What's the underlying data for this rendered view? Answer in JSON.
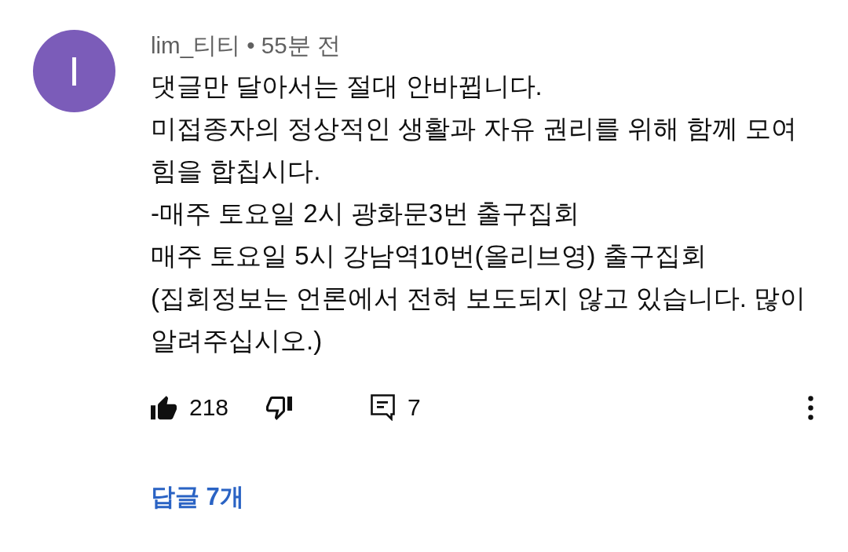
{
  "comment": {
    "avatar_letter": "I",
    "meta": "lim_티티 • 55분 전",
    "body_lines": [
      "댓글만 달아서는 절대 안바뀝니다.",
      "미접종자의 정상적인 생활과 자유 권리를 위해 함께 모여",
      "힘을 합칩시다.",
      "-매주 토요일 2시 광화문3번 출구집회",
      "매주 토요일 5시 강남역10번(올리브영) 출구집회",
      "(집회정보는 언론에서 전혀 보도되지 않고 있습니다. 많이",
      "알려주십시오.)"
    ],
    "like": {
      "count": "218",
      "on": true
    },
    "dislike": {
      "on": false
    },
    "reply_count": "7",
    "replies_link": "답글 7개"
  }
}
